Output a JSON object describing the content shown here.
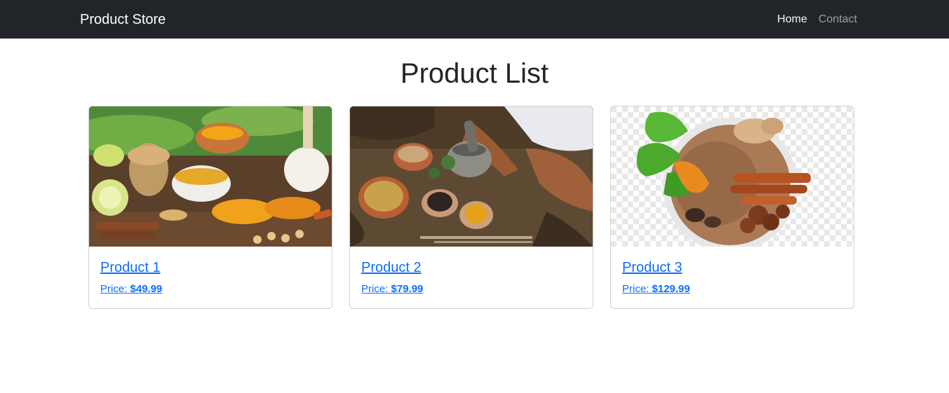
{
  "navbar": {
    "brand": "Product Store",
    "links": [
      {
        "label": "Home",
        "active": true
      },
      {
        "label": "Contact",
        "active": false
      }
    ]
  },
  "page": {
    "title": "Product List"
  },
  "products": [
    {
      "name": "Product 1",
      "price_label": "Price:",
      "price": "$49.99",
      "image": "spices-turmeric-photo"
    },
    {
      "name": "Product 2",
      "price_label": "Price:",
      "price": "$79.99",
      "image": "mortar-pestle-herbs-photo"
    },
    {
      "name": "Product 3",
      "price_label": "Price:",
      "price": "$129.99",
      "image": "spice-bowl-cinnamon-photo"
    }
  ],
  "colors": {
    "navbar_bg": "#212529",
    "link": "#0d6efd",
    "title": "#212529"
  }
}
